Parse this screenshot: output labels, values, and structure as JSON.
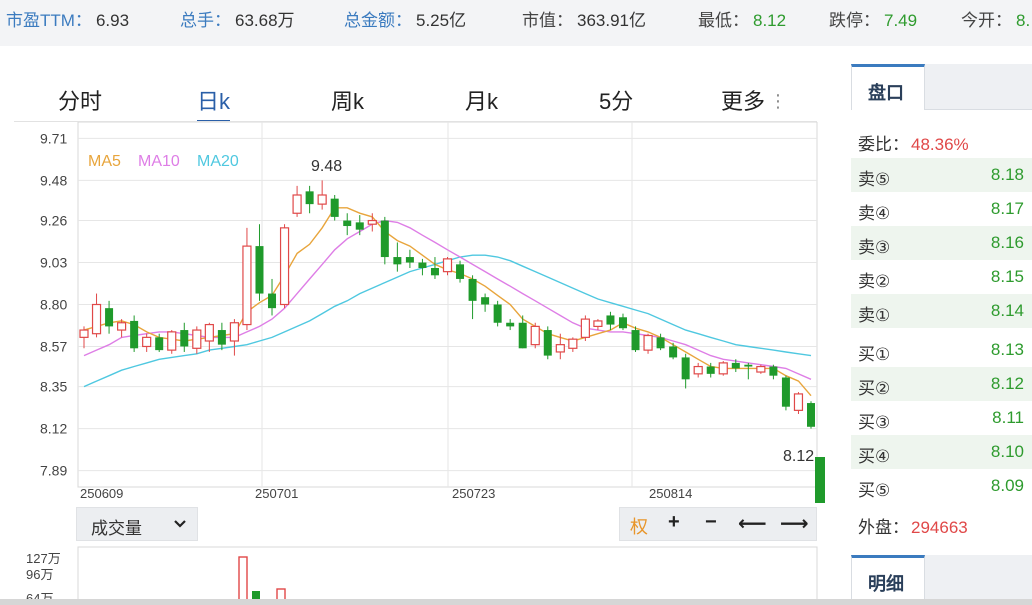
{
  "top_stats": [
    {
      "label": "市盈TTM：",
      "value": "6.93"
    },
    {
      "label": "总手：",
      "value": "63.68万"
    },
    {
      "label": "总金额：",
      "value": "5.25亿"
    },
    {
      "label": "市值：",
      "value": "363.91亿"
    },
    {
      "label": "最低：",
      "value": "8.12"
    },
    {
      "label": "跌停：",
      "value": "7.49"
    },
    {
      "label": "今开：",
      "value": "8."
    }
  ],
  "tabs": [
    "分时",
    "日k",
    "周k",
    "月k",
    "5分",
    "更多"
  ],
  "active_tab": "日k",
  "toolbar": {
    "volume_select": "成交量",
    "quan": "权",
    "zoom_in": "+",
    "zoom_out": "−",
    "left": "⟵",
    "right": "⟶"
  },
  "panel": {
    "tab": "盘口",
    "ratio_label": "委比：",
    "ratio_value": "48.36%",
    "asks": [
      {
        "name": "卖⑤",
        "price": "8.18"
      },
      {
        "name": "卖④",
        "price": "8.17"
      },
      {
        "name": "卖③",
        "price": "8.16"
      },
      {
        "name": "卖②",
        "price": "8.15"
      },
      {
        "name": "卖①",
        "price": "8.14"
      }
    ],
    "bids": [
      {
        "name": "买①",
        "price": "8.13"
      },
      {
        "name": "买②",
        "price": "8.12"
      },
      {
        "name": "买③",
        "price": "8.11"
      },
      {
        "name": "买④",
        "price": "8.10"
      },
      {
        "name": "买⑤",
        "price": "8.09"
      }
    ],
    "outer_label": "外盘：",
    "outer_value": "294663",
    "tab2": "明细"
  },
  "colors": {
    "up": "#e04848",
    "down": "#1f9a2b",
    "ma5": "#e8a53c",
    "ma10": "#de7ee6",
    "ma20": "#4fc8e0",
    "accent": "#2a5fa8"
  },
  "chart_data": {
    "type": "candlestick",
    "legend": [
      "MA5",
      "MA10",
      "MA20"
    ],
    "y_ticks": [
      "9.71",
      "9.48",
      "9.26",
      "9.03",
      "8.80",
      "8.57",
      "8.35",
      "8.12",
      "7.89"
    ],
    "x_ticks": [
      "250609",
      "250701",
      "250723",
      "250814"
    ],
    "high_label": "9.48",
    "low_label": "8.12",
    "candles": [
      {
        "o": 8.62,
        "h": 8.68,
        "l": 8.56,
        "c": 8.66
      },
      {
        "o": 8.64,
        "h": 8.86,
        "l": 8.62,
        "c": 8.8
      },
      {
        "o": 8.78,
        "h": 8.82,
        "l": 8.64,
        "c": 8.68
      },
      {
        "o": 8.66,
        "h": 8.72,
        "l": 8.62,
        "c": 8.7
      },
      {
        "o": 8.71,
        "h": 8.74,
        "l": 8.54,
        "c": 8.56
      },
      {
        "o": 8.57,
        "h": 8.64,
        "l": 8.54,
        "c": 8.62
      },
      {
        "o": 8.62,
        "h": 8.64,
        "l": 8.54,
        "c": 8.55
      },
      {
        "o": 8.55,
        "h": 8.66,
        "l": 8.53,
        "c": 8.65
      },
      {
        "o": 8.66,
        "h": 8.7,
        "l": 8.54,
        "c": 8.57
      },
      {
        "o": 8.56,
        "h": 8.68,
        "l": 8.53,
        "c": 8.66
      },
      {
        "o": 8.6,
        "h": 8.7,
        "l": 8.54,
        "c": 8.69
      },
      {
        "o": 8.66,
        "h": 8.7,
        "l": 8.55,
        "c": 8.58
      },
      {
        "o": 8.6,
        "h": 8.72,
        "l": 8.52,
        "c": 8.7
      },
      {
        "o": 8.69,
        "h": 9.22,
        "l": 8.66,
        "c": 9.12
      },
      {
        "o": 9.12,
        "h": 9.24,
        "l": 8.82,
        "c": 8.86
      },
      {
        "o": 8.86,
        "h": 8.94,
        "l": 8.74,
        "c": 8.78
      },
      {
        "o": 8.8,
        "h": 9.24,
        "l": 8.78,
        "c": 9.22
      },
      {
        "o": 9.3,
        "h": 9.45,
        "l": 9.28,
        "c": 9.4
      },
      {
        "o": 9.42,
        "h": 9.45,
        "l": 9.3,
        "c": 9.35
      },
      {
        "o": 9.35,
        "h": 9.48,
        "l": 9.32,
        "c": 9.4
      },
      {
        "o": 9.38,
        "h": 9.4,
        "l": 9.26,
        "c": 9.28
      },
      {
        "o": 9.26,
        "h": 9.3,
        "l": 9.18,
        "c": 9.23
      },
      {
        "o": 9.25,
        "h": 9.29,
        "l": 9.18,
        "c": 9.21
      },
      {
        "o": 9.24,
        "h": 9.3,
        "l": 9.2,
        "c": 9.26
      },
      {
        "o": 9.26,
        "h": 9.28,
        "l": 9.02,
        "c": 9.06
      },
      {
        "o": 9.06,
        "h": 9.14,
        "l": 8.98,
        "c": 9.02
      },
      {
        "o": 9.06,
        "h": 9.1,
        "l": 9.0,
        "c": 9.03
      },
      {
        "o": 9.03,
        "h": 9.05,
        "l": 8.96,
        "c": 9.0
      },
      {
        "o": 9.0,
        "h": 9.06,
        "l": 8.94,
        "c": 8.96
      },
      {
        "o": 8.98,
        "h": 9.06,
        "l": 8.96,
        "c": 9.05
      },
      {
        "o": 9.02,
        "h": 9.04,
        "l": 8.92,
        "c": 8.94
      },
      {
        "o": 8.94,
        "h": 8.96,
        "l": 8.72,
        "c": 8.82
      },
      {
        "o": 8.84,
        "h": 8.86,
        "l": 8.76,
        "c": 8.8
      },
      {
        "o": 8.8,
        "h": 8.82,
        "l": 8.68,
        "c": 8.7
      },
      {
        "o": 8.7,
        "h": 8.72,
        "l": 8.66,
        "c": 8.68
      },
      {
        "o": 8.7,
        "h": 8.74,
        "l": 8.56,
        "c": 8.56
      },
      {
        "o": 8.58,
        "h": 8.7,
        "l": 8.56,
        "c": 8.68
      },
      {
        "o": 8.66,
        "h": 8.68,
        "l": 8.5,
        "c": 8.52
      },
      {
        "o": 8.54,
        "h": 8.64,
        "l": 8.5,
        "c": 8.58
      },
      {
        "o": 8.56,
        "h": 8.62,
        "l": 8.54,
        "c": 8.61
      },
      {
        "o": 8.62,
        "h": 8.74,
        "l": 8.6,
        "c": 8.72
      },
      {
        "o": 8.68,
        "h": 8.72,
        "l": 8.66,
        "c": 8.71
      },
      {
        "o": 8.74,
        "h": 8.76,
        "l": 8.66,
        "c": 8.69
      },
      {
        "o": 8.73,
        "h": 8.75,
        "l": 8.66,
        "c": 8.67
      },
      {
        "o": 8.66,
        "h": 8.68,
        "l": 8.54,
        "c": 8.55
      },
      {
        "o": 8.55,
        "h": 8.64,
        "l": 8.53,
        "c": 8.63
      },
      {
        "o": 8.62,
        "h": 8.64,
        "l": 8.55,
        "c": 8.56
      },
      {
        "o": 8.57,
        "h": 8.59,
        "l": 8.5,
        "c": 8.51
      },
      {
        "o": 8.51,
        "h": 8.53,
        "l": 8.34,
        "c": 8.39
      },
      {
        "o": 8.42,
        "h": 8.48,
        "l": 8.4,
        "c": 8.46
      },
      {
        "o": 8.46,
        "h": 8.48,
        "l": 8.4,
        "c": 8.42
      },
      {
        "o": 8.42,
        "h": 8.49,
        "l": 8.41,
        "c": 8.48
      },
      {
        "o": 8.48,
        "h": 8.5,
        "l": 8.43,
        "c": 8.45
      },
      {
        "o": 8.47,
        "h": 8.48,
        "l": 8.39,
        "c": 8.46
      },
      {
        "o": 8.43,
        "h": 8.47,
        "l": 8.42,
        "c": 8.46
      },
      {
        "o": 8.46,
        "h": 8.47,
        "l": 8.39,
        "c": 8.41
      },
      {
        "o": 8.4,
        "h": 8.41,
        "l": 8.22,
        "c": 8.24
      },
      {
        "o": 8.22,
        "h": 8.32,
        "l": 8.2,
        "c": 8.31
      },
      {
        "o": 8.26,
        "h": 8.27,
        "l": 8.12,
        "c": 8.13
      }
    ],
    "ma5": [
      8.66,
      8.68,
      8.7,
      8.71,
      8.69,
      8.65,
      8.62,
      8.61,
      8.6,
      8.61,
      8.62,
      8.63,
      8.64,
      8.76,
      8.81,
      8.85,
      8.96,
      9.08,
      9.13,
      9.22,
      9.33,
      9.33,
      9.3,
      9.28,
      9.2,
      9.15,
      9.12,
      9.07,
      9.02,
      8.99,
      8.97,
      8.94,
      8.9,
      8.85,
      8.8,
      8.72,
      8.68,
      8.64,
      8.62,
      8.6,
      8.62,
      8.64,
      8.66,
      8.7,
      8.67,
      8.65,
      8.62,
      8.58,
      8.54,
      8.5,
      8.46,
      8.45,
      8.45,
      8.45,
      8.45,
      8.45,
      8.41,
      8.38,
      8.3
    ],
    "ma10": [
      8.52,
      8.55,
      8.58,
      8.62,
      8.63,
      8.64,
      8.65,
      8.65,
      8.64,
      8.63,
      8.62,
      8.62,
      8.62,
      8.65,
      8.68,
      8.72,
      8.78,
      8.86,
      8.94,
      9.02,
      9.1,
      9.16,
      9.2,
      9.24,
      9.26,
      9.25,
      9.22,
      9.18,
      9.14,
      9.1,
      9.06,
      9.02,
      8.98,
      8.94,
      8.9,
      8.86,
      8.82,
      8.78,
      8.74,
      8.7,
      8.67,
      8.66,
      8.65,
      8.65,
      8.64,
      8.63,
      8.62,
      8.6,
      8.58,
      8.55,
      8.52,
      8.5,
      8.49,
      8.48,
      8.47,
      8.46,
      8.45,
      8.42,
      8.39
    ],
    "ma20": [
      8.35,
      8.38,
      8.41,
      8.44,
      8.46,
      8.48,
      8.5,
      8.51,
      8.52,
      8.53,
      8.55,
      8.56,
      8.57,
      8.58,
      8.6,
      8.62,
      8.65,
      8.68,
      8.71,
      8.75,
      8.79,
      8.82,
      8.86,
      8.89,
      8.92,
      8.95,
      8.98,
      9.0,
      9.02,
      9.04,
      9.06,
      9.07,
      9.07,
      9.06,
      9.04,
      9.01,
      8.98,
      8.95,
      8.92,
      8.89,
      8.86,
      8.83,
      8.81,
      8.79,
      8.77,
      8.75,
      8.72,
      8.69,
      8.66,
      8.64,
      8.62,
      8.6,
      8.58,
      8.57,
      8.56,
      8.55,
      8.54,
      8.53,
      8.52
    ],
    "volume_labels": [
      "127万",
      "96万",
      "64万"
    ]
  }
}
